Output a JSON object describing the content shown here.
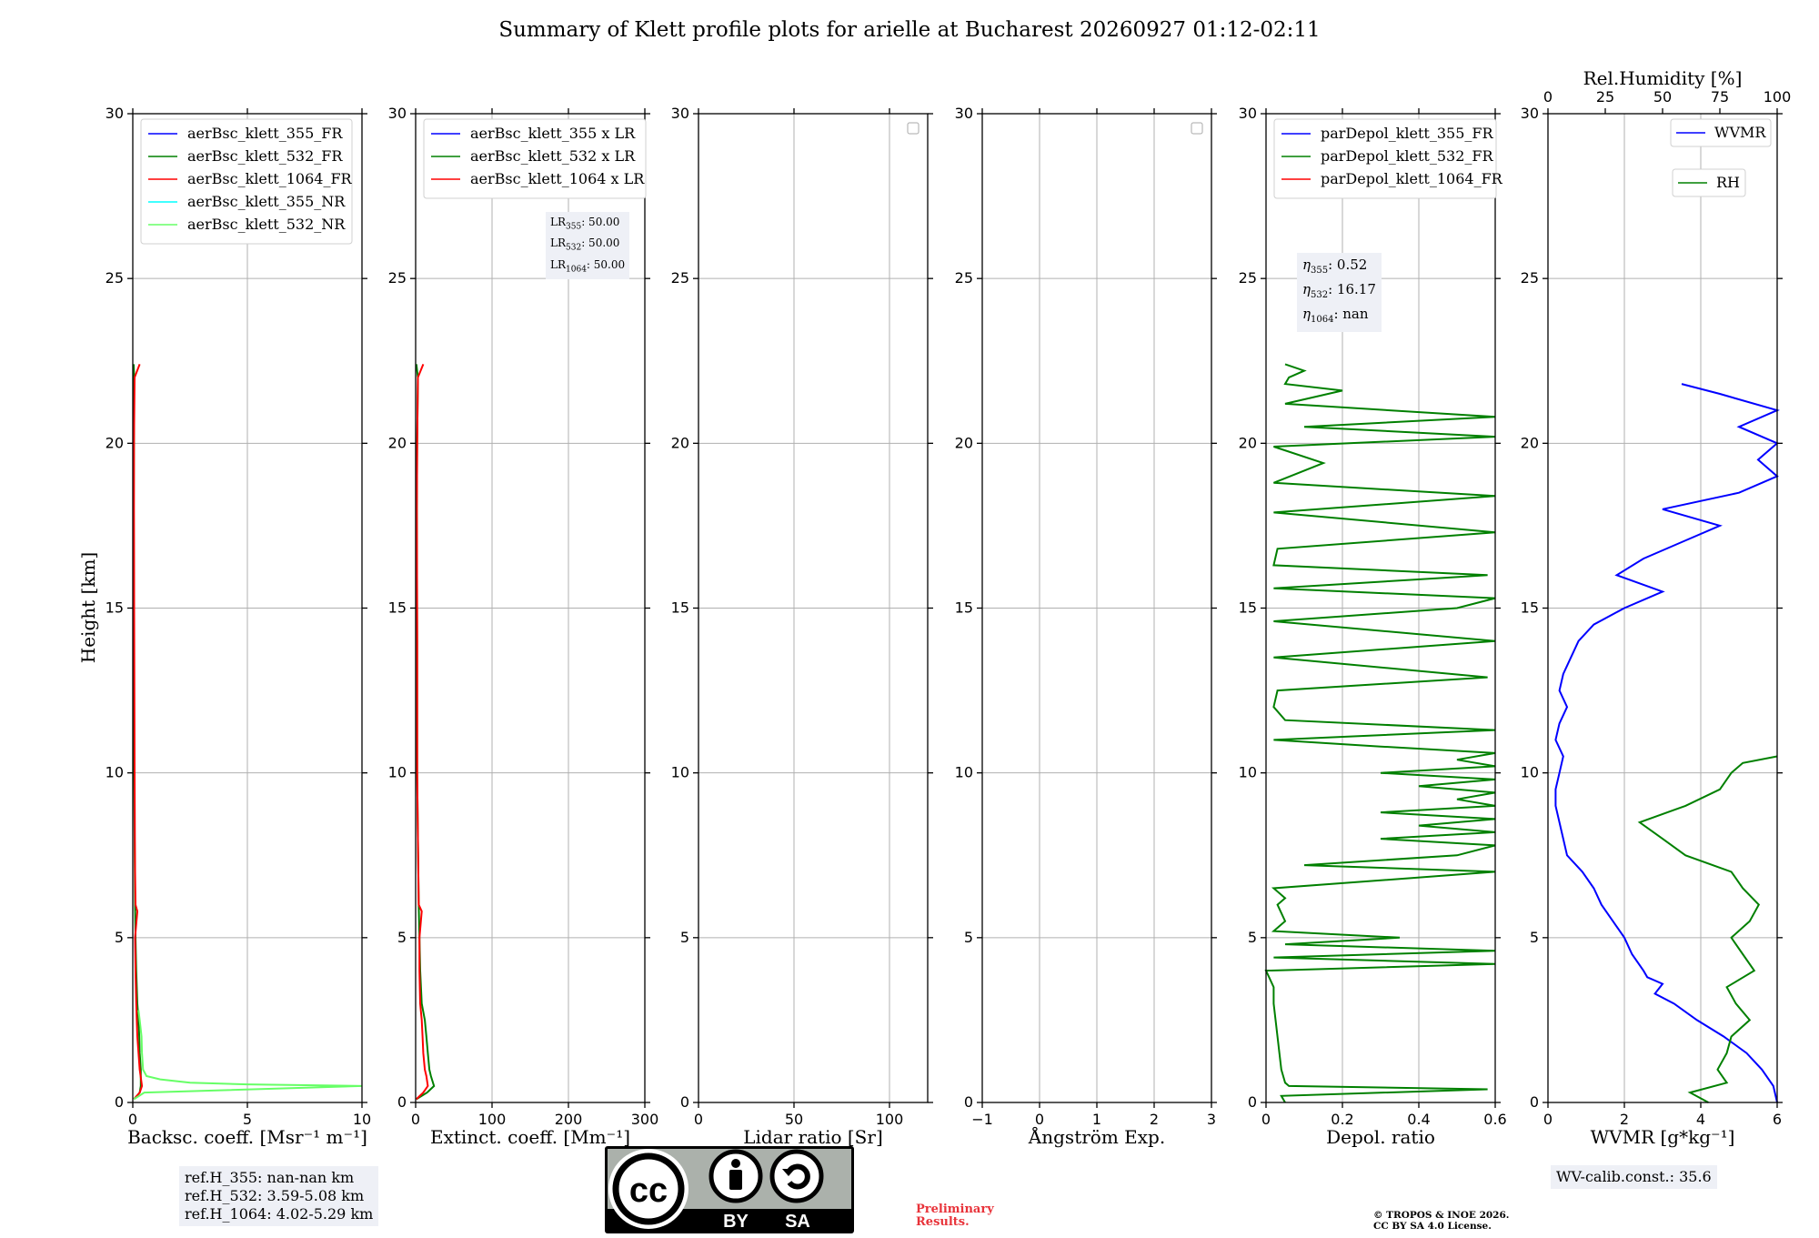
{
  "title": "Summary of Klett profile plots for arielle at Bucharest 20260927 01:12-02:11",
  "colors": {
    "blue": "#0000ff",
    "green": "#008000",
    "red": "#ff0000",
    "cyan": "#00ffff",
    "lightgreen": "#66ff66",
    "grid": "#b0b0b0",
    "boxbg": "#eef0f6"
  },
  "shared_y": {
    "label": "Height [km]",
    "range": [
      0,
      30
    ],
    "ticks": [
      0,
      5,
      10,
      15,
      20,
      25,
      30
    ]
  },
  "info": {
    "refH": [
      "ref.H_355: nan-nan km",
      "ref.H_532: 3.59-5.08 km",
      "ref.H_1064: 4.02-5.29 km"
    ],
    "lr": [
      [
        "LR",
        "355",
        ": 50.00"
      ],
      [
        "LR",
        "532",
        ": 50.00"
      ],
      [
        "LR",
        "1064",
        ": 50.00"
      ]
    ],
    "eta": [
      [
        "η",
        "355",
        ": 0.52"
      ],
      [
        "η",
        "532",
        ": 16.17"
      ],
      [
        "η",
        "1064",
        ": nan"
      ]
    ],
    "wv_calib": "WV-calib.const.: 35.6",
    "preliminary": [
      "Preliminary",
      "Results."
    ],
    "copyright": [
      "© TROPOS & INOE 2026.",
      "CC BY SA 4.0 License."
    ],
    "cc_badge": {
      "by": "BY",
      "sa": "SA",
      "cc": "cc"
    }
  },
  "chart_data": [
    {
      "type": "line",
      "xlabel": "Backsc. coeff. [Msr⁻¹ m⁻¹]",
      "xlim": [
        0,
        10
      ],
      "xticks": [
        0,
        5,
        10
      ],
      "ylabel": "Height [km]",
      "ylim": [
        0,
        30
      ],
      "grid": true,
      "legend": "top-left",
      "series": [
        {
          "name": "aerBsc_klett_355_FR",
          "color": "blue",
          "y": [],
          "x": []
        },
        {
          "name": "aerBsc_klett_532_FR",
          "color": "green",
          "y": [
            0.1,
            0.3,
            0.5,
            1.0,
            1.5,
            2.0,
            2.5,
            3.0,
            4.0,
            5.0,
            6.0,
            8.0,
            10.0,
            12.0,
            15.0,
            18.0,
            20.0,
            22.0,
            22.4
          ],
          "x": [
            0.05,
            0.3,
            0.35,
            0.35,
            0.3,
            0.28,
            0.25,
            0.2,
            0.15,
            0.12,
            0.1,
            0.08,
            0.06,
            0.05,
            0.05,
            0.04,
            0.05,
            0.06,
            0.04
          ]
        },
        {
          "name": "aerBsc_klett_1064_FR",
          "color": "red",
          "y": [
            0.1,
            0.3,
            0.5,
            1.0,
            2.0,
            3.0,
            4.0,
            5.0,
            5.8,
            6.0,
            7.0,
            8.0,
            10.0,
            12.0,
            15.0,
            18.0,
            20.0,
            22.0,
            22.4
          ],
          "x": [
            0.05,
            0.3,
            0.4,
            0.3,
            0.2,
            0.15,
            0.12,
            0.1,
            0.2,
            0.12,
            0.1,
            0.09,
            0.08,
            0.07,
            0.06,
            0.05,
            0.05,
            0.08,
            0.3
          ]
        },
        {
          "name": "aerBsc_klett_355_NR",
          "color": "cyan",
          "y": [],
          "x": []
        },
        {
          "name": "aerBsc_klett_532_NR",
          "color": "lightgreen",
          "y": [
            0.1,
            0.3,
            0.5,
            0.55,
            0.6,
            0.7,
            0.8,
            1.0,
            1.5,
            2.0,
            2.5,
            2.8
          ],
          "x": [
            0.05,
            0.5,
            10,
            5,
            2.5,
            1.2,
            0.6,
            0.45,
            0.4,
            0.38,
            0.3,
            0.25
          ]
        }
      ]
    },
    {
      "type": "line",
      "xlabel": "Extinct. coeff. [Mm⁻¹]",
      "xlim": [
        0,
        300
      ],
      "xticks": [
        0,
        100,
        200,
        300
      ],
      "ylim": [
        0,
        30
      ],
      "grid": true,
      "legend": "top-left",
      "series": [
        {
          "name": "aerBsc_klett_355 x LR",
          "color": "blue",
          "y": [],
          "x": []
        },
        {
          "name": "aerBsc_klett_532 x LR",
          "color": "green",
          "y": [
            0.1,
            0.3,
            0.5,
            0.8,
            1.0,
            1.5,
            2.0,
            2.5,
            3.0,
            4.0,
            5.0,
            6.0,
            8.0,
            10.0,
            14.0,
            18.0,
            20.0,
            22.0,
            22.4
          ],
          "x": [
            1,
            15,
            24,
            20,
            18,
            16,
            14,
            12,
            8,
            6,
            5,
            4,
            3,
            2,
            2,
            1.5,
            2,
            3,
            1
          ]
        },
        {
          "name": "aerBsc_klett_1064 x LR",
          "color": "red",
          "y": [
            0.1,
            0.3,
            0.5,
            0.8,
            1.0,
            1.5,
            2.0,
            2.5,
            3.0,
            4.0,
            5.0,
            5.8,
            6.0,
            8.0,
            10.0,
            14.0,
            18.0,
            20.0,
            22.0,
            22.4
          ],
          "x": [
            1,
            10,
            16,
            14,
            12,
            10,
            9,
            8,
            6,
            5,
            5,
            8,
            4,
            3,
            2,
            2,
            1.5,
            2,
            3,
            10
          ]
        }
      ]
    },
    {
      "type": "line",
      "xlabel": "Lidar ratio [Sr]",
      "xlim": [
        0,
        120
      ],
      "xticks": [
        0,
        50,
        100
      ],
      "ylim": [
        0,
        30
      ],
      "grid": true,
      "legend": "top-right",
      "series": []
    },
    {
      "type": "line",
      "xlabel": "Ångström Exp.",
      "xlim": [
        -1,
        3
      ],
      "xticks": [
        -1,
        0,
        1,
        2,
        3
      ],
      "ylim": [
        0,
        30
      ],
      "grid": true,
      "legend": "top-right",
      "series": []
    },
    {
      "type": "line",
      "xlabel": "Depol. ratio",
      "xlim": [
        0,
        0.6
      ],
      "xticks": [
        0.0,
        0.2,
        0.4,
        0.6
      ],
      "ylim": [
        0,
        30
      ],
      "grid": true,
      "legend": "top-left",
      "series": [
        {
          "name": "parDepol_klett_355_FR",
          "color": "blue",
          "y": [],
          "x": []
        },
        {
          "name": "parDepol_klett_532_FR",
          "color": "green",
          "y": [
            0.0,
            0.2,
            0.4,
            0.5,
            0.6,
            0.8,
            1.0,
            1.5,
            2.0,
            2.5,
            3.0,
            3.5,
            4.0,
            4.2,
            4.4,
            4.6,
            4.8,
            5.0,
            5.2,
            5.5,
            6.0,
            6.2,
            6.5,
            7.0,
            7.2,
            7.5,
            7.8,
            8.0,
            8.2,
            8.4,
            8.6,
            8.8,
            9.0,
            9.2,
            9.4,
            9.6,
            9.8,
            10.0,
            10.2,
            10.4,
            10.6,
            10.8,
            11.0,
            11.3,
            11.6,
            12.0,
            12.5,
            12.9,
            13.5,
            14.0,
            14.6,
            15.0,
            15.3,
            15.6,
            16.0,
            16.3,
            16.8,
            17.3,
            17.9,
            18.4,
            18.8,
            19.4,
            19.9,
            20.2,
            20.5,
            20.8,
            21.2,
            21.6,
            21.8,
            22.0,
            22.2,
            22.4
          ],
          "x": [
            0.05,
            0.04,
            0.58,
            0.06,
            0.05,
            0.045,
            0.04,
            0.035,
            0.03,
            0.025,
            0.02,
            0.02,
            0.0,
            0.6,
            0.02,
            0.6,
            0.05,
            0.35,
            0.02,
            0.05,
            0.03,
            0.05,
            0.02,
            0.6,
            0.1,
            0.5,
            0.6,
            0.3,
            0.6,
            0.4,
            0.6,
            0.3,
            0.6,
            0.5,
            0.6,
            0.4,
            0.6,
            0.3,
            0.6,
            0.5,
            0.6,
            0.3,
            0.02,
            0.6,
            0.05,
            0.02,
            0.03,
            0.58,
            0.02,
            0.6,
            0.02,
            0.5,
            0.6,
            0.02,
            0.58,
            0.02,
            0.03,
            0.6,
            0.02,
            0.6,
            0.02,
            0.15,
            0.02,
            0.6,
            0.1,
            0.6,
            0.05,
            0.2,
            0.05,
            0.06,
            0.1,
            0.05
          ]
        },
        {
          "name": "parDepol_klett_1064_FR",
          "color": "red",
          "y": [],
          "x": []
        }
      ]
    },
    {
      "type": "line",
      "xlabel": "WVMR [g*kg⁻¹]",
      "xlim": [
        0,
        6
      ],
      "xticks": [
        0,
        2,
        4,
        6
      ],
      "x2label": "Rel.Humidity [%]",
      "x2lim": [
        0,
        100
      ],
      "x2ticks": [
        0,
        25,
        50,
        75,
        100
      ],
      "ylim": [
        0,
        30
      ],
      "grid": true,
      "legend": "top-right",
      "series": [
        {
          "name": "WVMR",
          "color": "blue",
          "axis": "bottom",
          "y": [
            0.0,
            0.5,
            1.0,
            1.5,
            2.0,
            2.5,
            3.0,
            3.3,
            3.6,
            3.8,
            4.0,
            4.5,
            5.0,
            5.5,
            6.0,
            6.5,
            7.0,
            7.5,
            8.0,
            8.5,
            9.0,
            9.5,
            10.0,
            10.5,
            11.0,
            11.5,
            12.0,
            12.5,
            13.0,
            13.5,
            14.0,
            14.5,
            15.0,
            15.5,
            16.0,
            16.5,
            17.0,
            17.5,
            18.0,
            18.5,
            19.0,
            19.5,
            20.0,
            20.5,
            21.0,
            21.5,
            21.8
          ],
          "x": [
            6.0,
            5.9,
            5.6,
            5.2,
            4.6,
            3.9,
            3.3,
            2.8,
            3.0,
            2.6,
            2.5,
            2.2,
            2.0,
            1.7,
            1.4,
            1.2,
            0.9,
            0.5,
            0.4,
            0.3,
            0.2,
            0.2,
            0.3,
            0.4,
            0.2,
            0.3,
            0.5,
            0.3,
            0.4,
            0.6,
            0.8,
            1.2,
            2.0,
            3.0,
            1.8,
            2.5,
            3.5,
            4.5,
            3.0,
            5.0,
            6.0,
            5.5,
            6.0,
            5.0,
            6.0,
            4.5,
            3.5
          ]
        },
        {
          "name": "RH",
          "color": "green",
          "axis": "top",
          "y": [
            0.0,
            0.3,
            0.6,
            1.0,
            1.5,
            2.0,
            2.5,
            3.0,
            3.5,
            4.0,
            4.5,
            5.0,
            5.5,
            6.0,
            6.5,
            7.0,
            7.5,
            8.0,
            8.5,
            9.0,
            9.5,
            10.0,
            10.3,
            10.5
          ],
          "x": [
            70,
            62,
            78,
            74,
            78,
            80,
            88,
            82,
            78,
            90,
            85,
            80,
            88,
            92,
            85,
            80,
            60,
            50,
            40,
            60,
            75,
            80,
            85,
            100
          ]
        }
      ]
    }
  ]
}
